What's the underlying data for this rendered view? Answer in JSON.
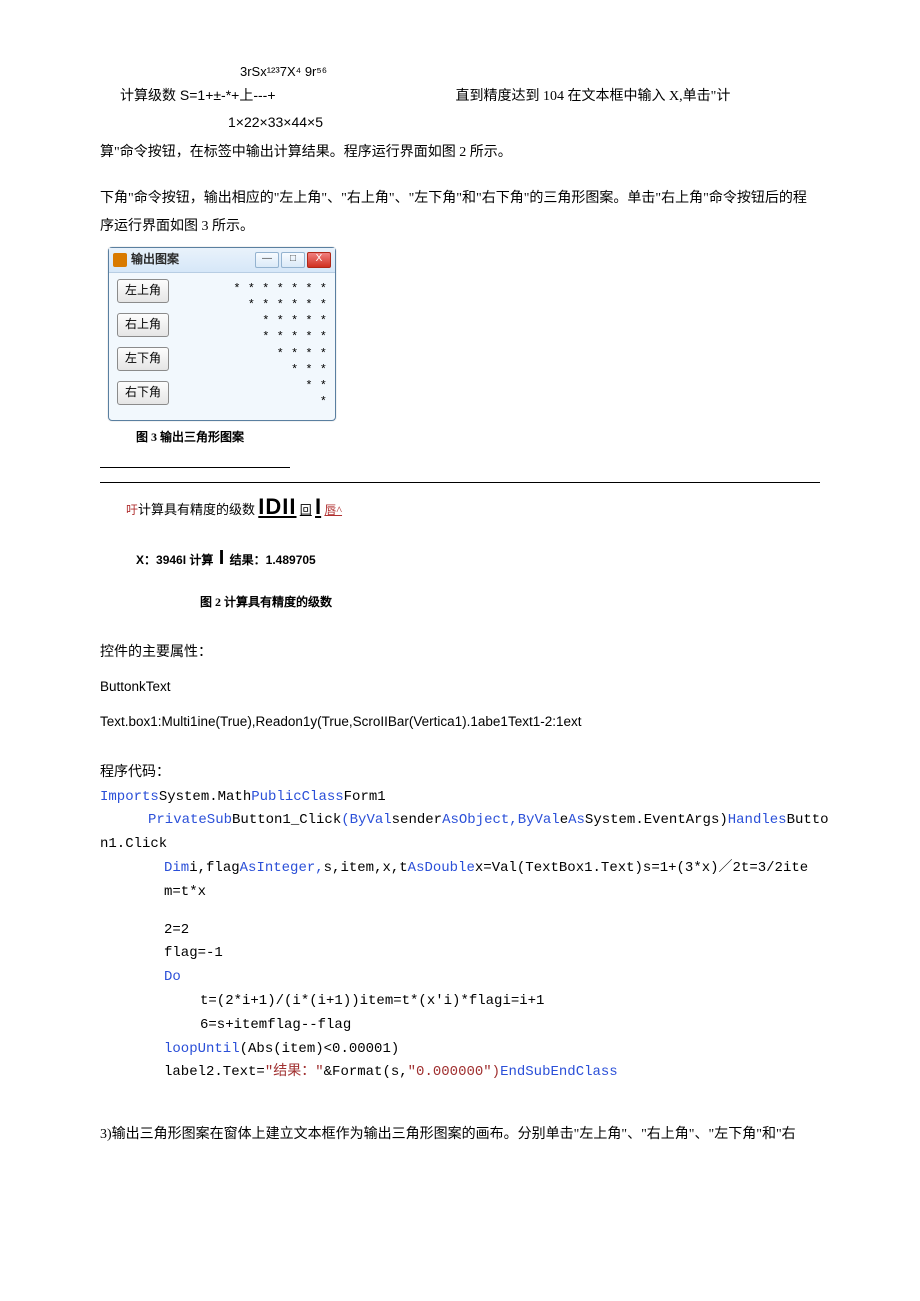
{
  "formula": {
    "top": "3rSx¹²³7X⁴            9r⁵⁶",
    "mid_lhs": "计算级数 S=1+±-*+上---+",
    "mid_rhs": "直到精度达到 104 在文本框中输入 X,单击\"计",
    "bot": "1×22×33×44×5"
  },
  "para1": "算\"命令按钮，在标签中输出计算结果。程序运行界面如图 2 所示。",
  "para2": "下角\"命令按钮，输出相应的\"左上角\"、\"右上角\"、\"左下角\"和\"右下角\"的三角形图案。单击\"右上角\"命令按钮后的程序运行界面如图 3 所示。",
  "window": {
    "title": "输出图案",
    "min": "—",
    "max": "□",
    "close": "X",
    "buttons": [
      "左上角",
      "右上角",
      "左下角",
      "右下角"
    ],
    "pattern": "* * * * * * *\n* * * * * *\n* * * * *\n* * * * *\n* * * *\n* * *\n* *\n*"
  },
  "fig3": "图 3 输出三角形图案",
  "series_line": {
    "prefix_red": "吁",
    "text": "计算具有精度的级数",
    "big": "IDII",
    "mid": "回",
    "bar": "I",
    "suffix_red": "唇^"
  },
  "result_line": {
    "x_label": "X：",
    "x_value": "3946I",
    "calc": "计算",
    "bar": "I",
    "res_label": "结果：",
    "res_value": "1.489705"
  },
  "fig2": "图 2 计算具有精度的级数",
  "props_header": "控件的主要属性：",
  "props_line1": "ButtonkText",
  "props_line2": "Text.box1:Multi1ine(True),Readon1y(True,ScroIIBar(Vertica1).1abe1Text1-2:1ext",
  "code_header": "程序代码：",
  "code": {
    "l1_a": "Imports",
    "l1_b": "System.Math",
    "l1_c": "PublicClass",
    "l1_d": "Form1",
    "l2_a": "PrivateSub",
    "l2_b": "Button1_Click",
    "l2_c": "(ByVal",
    "l2_d": "sender",
    "l2_e": "AsObject,ByVal",
    "l2_f": "e",
    "l2_g": "As",
    "l2_h": "System.EventArgs)",
    "l2_i": "Handles",
    "l2_j": "Butto",
    "l3": "n1.Click",
    "l4_a": "Dim",
    "l4_b": "i,flag",
    "l4_c": "AsInteger,",
    "l4_d": "s,item,x,t",
    "l4_e": "AsDouble",
    "l4_f": "x=Val(TextBox1.Text)s=1+(3*x)／2t=3/2ite",
    "l5": "m=t*x",
    "l6": "2=2",
    "l7": "flag=-1",
    "l8": "Do",
    "l9": "t=(2*i+1)/(i*(i+1))item=t*(x'i)*flagi=i+1",
    "l10": "6=s+itemflag--flag",
    "l11_a": "loopUntil",
    "l11_b": "(Abs(item)<0.00001)",
    "l12_a": "label2.Text=",
    "l12_b": "\"结果：\"",
    "l12_c": "&Format(s,",
    "l12_d": "\"0.000000\")",
    "l12_e": "EndSubEndClass"
  },
  "bottom": "3)输出三角形图案在窗体上建立文本框作为输出三角形图案的画布。分别单击\"左上角\"、\"右上角\"、\"左下角\"和\"右"
}
